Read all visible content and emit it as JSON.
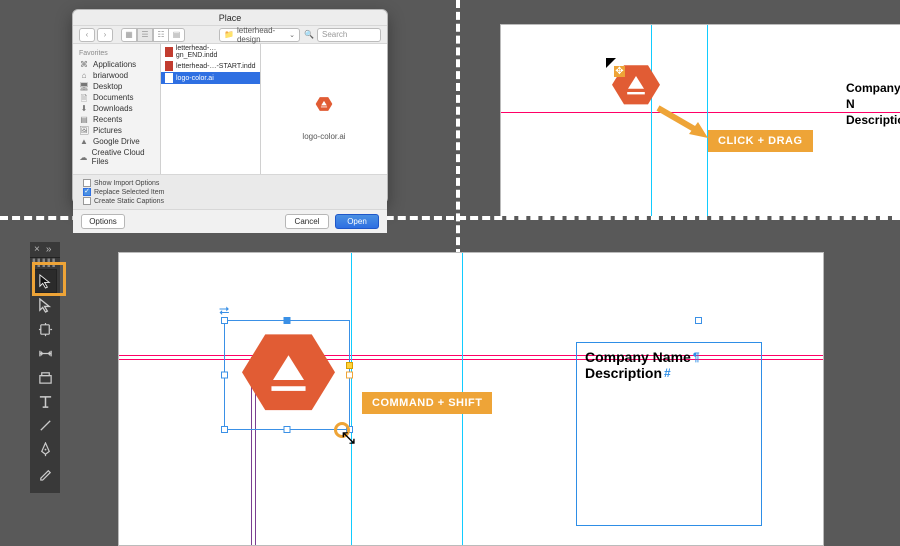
{
  "dialog": {
    "title": "Place",
    "folder": "letterhead-design",
    "search_placeholder": "Search",
    "sidebar": {
      "header": "Favorites",
      "items": [
        "Applications",
        "briarwood",
        "Desktop",
        "Documents",
        "Downloads",
        "Recents",
        "Pictures",
        "Google Drive",
        "Creative Cloud Files"
      ]
    },
    "files": [
      "letterhead-…gn_END.indd",
      "letterhead-…-START.indd",
      "logo-color.ai"
    ],
    "selected_index": 2,
    "preview_name": "logo-color.ai",
    "options": {
      "show_import": {
        "label": "Show Import Options",
        "checked": false
      },
      "replace_selected": {
        "label": "Replace Selected Item",
        "checked": true
      },
      "create_captions": {
        "label": "Create Static Captions",
        "checked": false
      }
    },
    "options_btn": "Options",
    "cancel": "Cancel",
    "open": "Open"
  },
  "top_right": {
    "callout": "CLICK + DRAG",
    "company": "Company N",
    "description": "Description"
  },
  "bottom": {
    "callout": "COMMAND + SHIFT",
    "company": "Company Name",
    "description": "Description",
    "tool_names": [
      "selection-tool",
      "direct-selection-tool",
      "page-tool",
      "gap-tool",
      "content-collector-tool",
      "type-tool",
      "line-tool",
      "pen-tool",
      "pencil-tool"
    ]
  },
  "colors": {
    "accent": "#e15c34",
    "annot": "#eea437",
    "select": "#2e6fe2",
    "guide_pink": "#ff0066",
    "guide_cyan": "#14cfff"
  }
}
